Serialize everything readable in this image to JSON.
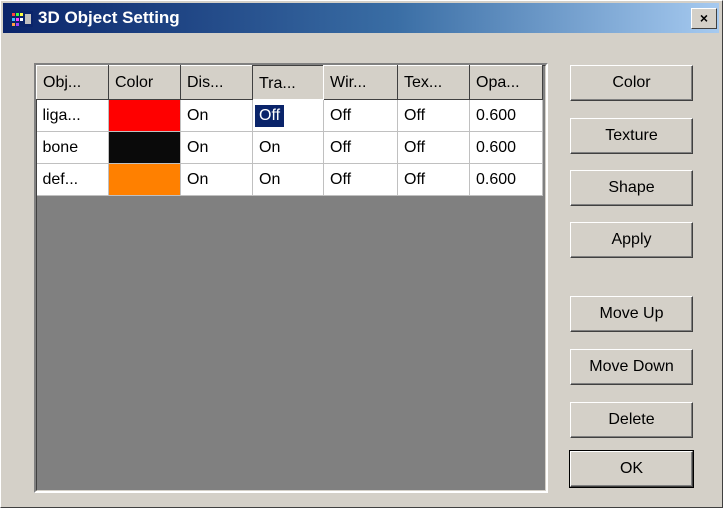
{
  "window": {
    "title": "3D Object Setting",
    "close_glyph": "×"
  },
  "table": {
    "columns": [
      "Obj...",
      "Color",
      "Dis...",
      "Tra...",
      "Wir...",
      "Tex...",
      "Opa..."
    ],
    "rows": [
      {
        "object": "liga...",
        "color": "#ff0000",
        "display": "On",
        "transparency": "Off",
        "wireframe": "Off",
        "texture": "Off",
        "opacity": "0.600"
      },
      {
        "object": "bone",
        "color": "#0a0a0a",
        "display": "On",
        "transparency": "On",
        "wireframe": "Off",
        "texture": "Off",
        "opacity": "0.600"
      },
      {
        "object": "def...",
        "color": "#ff8000",
        "display": "On",
        "transparency": "On",
        "wireframe": "Off",
        "texture": "Off",
        "opacity": "0.600"
      }
    ],
    "selected_cell": "row 1, transparency"
  },
  "buttons": {
    "color": "Color",
    "texture": "Texture",
    "shape": "Shape",
    "apply": "Apply",
    "move_up": "Move Up",
    "move_down": "Move Down",
    "delete": "Delete",
    "ok": "OK"
  },
  "colors": {
    "title_start": "#0a246a",
    "title_end": "#a6caf0",
    "face": "#d4d0c8",
    "list_bg": "#808080",
    "selection": "#0a246a"
  }
}
